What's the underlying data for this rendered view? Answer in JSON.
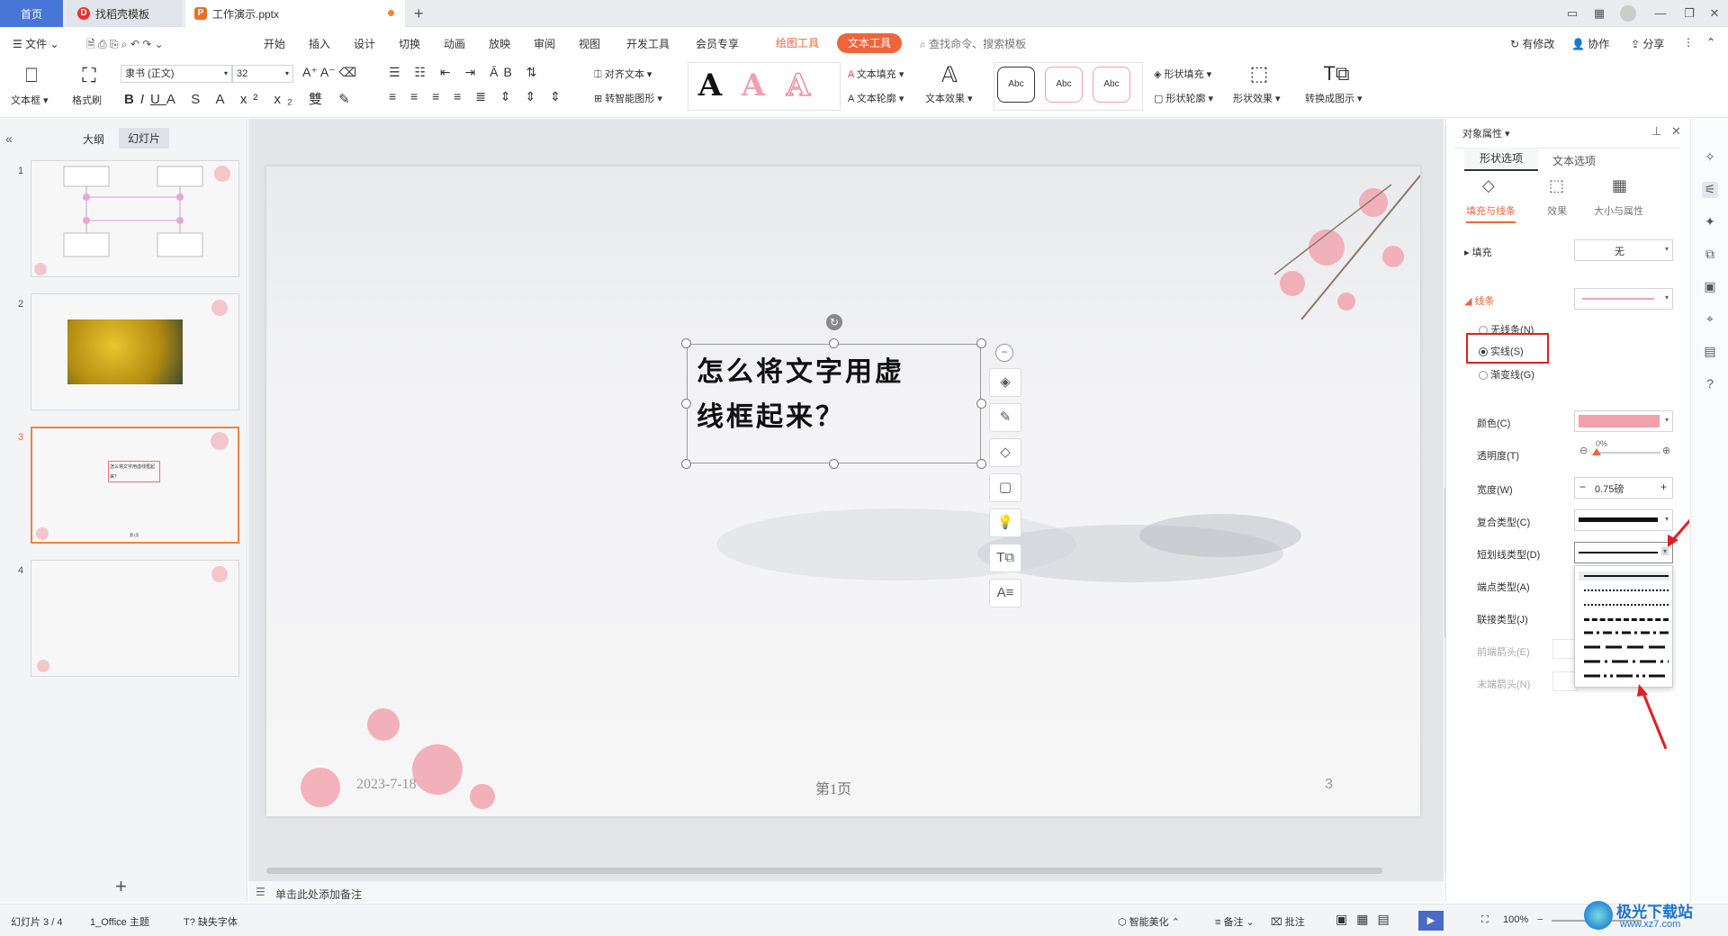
{
  "tabs": {
    "home": "首页",
    "docer": "找稻壳模板",
    "file": "工作演示.pptx",
    "new_tab": "+"
  },
  "menu": {
    "file": "文件",
    "items": [
      "开始",
      "插入",
      "设计",
      "切换",
      "动画",
      "放映",
      "审阅",
      "视图",
      "开发工具",
      "会员专享"
    ],
    "drawing_tools": "绘图工具",
    "text_tools": "文本工具",
    "search": "查找命令、搜索模板",
    "right": {
      "modify": "有修改",
      "collab": "协作",
      "share": "分享"
    }
  },
  "ribbon": {
    "textbox": "文本框",
    "format_painter": "格式刷",
    "font": "隶书 (正文)",
    "size": "32",
    "align_text": "对齐文本",
    "smart_art": "转智能图形",
    "text_fill": "文本填充",
    "text_outline": "文本轮廓",
    "text_effect": "文本效果",
    "wordart_a": "A",
    "abc": "Abc",
    "shape_fill": "形状填充",
    "shape_outline": "形状轮廓",
    "shape_effect": "形状效果",
    "convert": "转换成图示"
  },
  "left_panel": {
    "outline_tab": "大纲",
    "slides_tab": "幻灯片",
    "slide_numbers": [
      "1",
      "2",
      "3",
      "4"
    ],
    "add": "+",
    "thumb3_text": "怎么将文字用虚线框起来？",
    "thumb_footer": "第1页"
  },
  "slide": {
    "title_line1": "怎么将文字用虚",
    "title_line2": "线框起来？",
    "date": "2023-7-18",
    "page": "第1页",
    "number": "3"
  },
  "notes": "单击此处添加备注",
  "right_panel": {
    "header": "对象属性",
    "tab_shape": "形状选项",
    "tab_text": "文本选项",
    "sub_fill_line": "填充与线条",
    "sub_effect": "效果",
    "sub_size": "大小与属性",
    "fill_label": "填充",
    "fill_value": "无",
    "line_label": "线条",
    "no_line": "无线条(N)",
    "solid_line": "实线(S)",
    "gradient_line": "渐变线(G)",
    "color": "颜色(C)",
    "transparency": "透明度(T)",
    "transparency_value": "0%",
    "width": "宽度(W)",
    "width_value": "0.75磅",
    "compound": "复合类型(C)",
    "dash": "短划线类型(D)",
    "cap": "端点类型(A)",
    "join": "联接类型(J)",
    "begin_arrow": "前端箭头(E)",
    "end_arrow": "末端箭头(N)",
    "accent_color": "#f4a0ac"
  },
  "status": {
    "slide": "幻灯片 3 / 4",
    "theme": "1_Office 主题",
    "missing_font": "缺失字体",
    "beautify": "智能美化",
    "notes": "备注",
    "comment": "批注",
    "zoom": "100%"
  },
  "watermark": {
    "brand": "极光下载站",
    "url": "www.xz7.com"
  }
}
